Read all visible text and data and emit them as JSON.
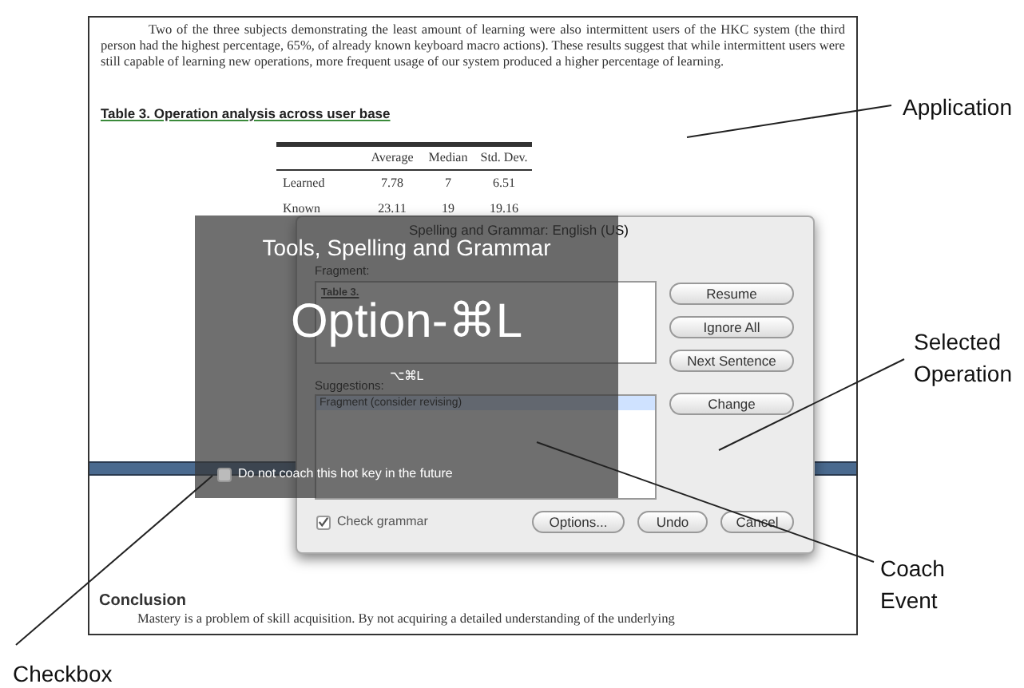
{
  "document": {
    "paragraph": "Two of the three subjects demonstrating the least amount of learning were also intermittent users of the HKC system (the third person had the highest percentage, 65%, of already known keyboard macro actions). These results suggest that while intermittent users were still capable of learning new operations, more frequent usage of our system produced a higher percentage of learning.",
    "table_caption": "Table 3.  Operation analysis across user base",
    "table": {
      "columns": [
        "Average",
        "Median",
        "Std. Dev."
      ],
      "rows": [
        {
          "label": "Learned",
          "cells": [
            "7.78",
            "7",
            "6.51"
          ]
        },
        {
          "label": "Known",
          "cells": [
            "23.11",
            "19",
            "19.16"
          ]
        }
      ]
    },
    "conclusion_heading": "Conclusion",
    "conclusion_text": "Mastery is a problem of skill acquisition.  By not acquiring a detailed understanding of the underlying"
  },
  "dialog": {
    "title": "Spelling and Grammar: English (US)",
    "fragment_label": "Fragment:",
    "fragment_text": "Table 3.",
    "suggestions_label": "Suggestions:",
    "suggestions": [
      {
        "text": "Fragment (consider revising)",
        "selected": true
      }
    ],
    "side_buttons": [
      "Resume",
      "Ignore All",
      "Next Sentence",
      "Change"
    ],
    "check_grammar": {
      "label": "Check grammar",
      "checked": true
    },
    "bottom_buttons": [
      "Options...",
      "Undo",
      "Cancel"
    ]
  },
  "coach": {
    "command": "Tools, Spelling and Grammar",
    "hotkey": "Option-⌘L",
    "hotkey_symbols": "⌥⌘L",
    "dont_coach": {
      "label": "Do not coach this hot key in the future",
      "checked": false
    }
  },
  "annotations": [
    {
      "label": "Application"
    },
    {
      "label": "Selected Operation"
    },
    {
      "label": "Coach Event"
    },
    {
      "label": "Checkbox"
    }
  ]
}
